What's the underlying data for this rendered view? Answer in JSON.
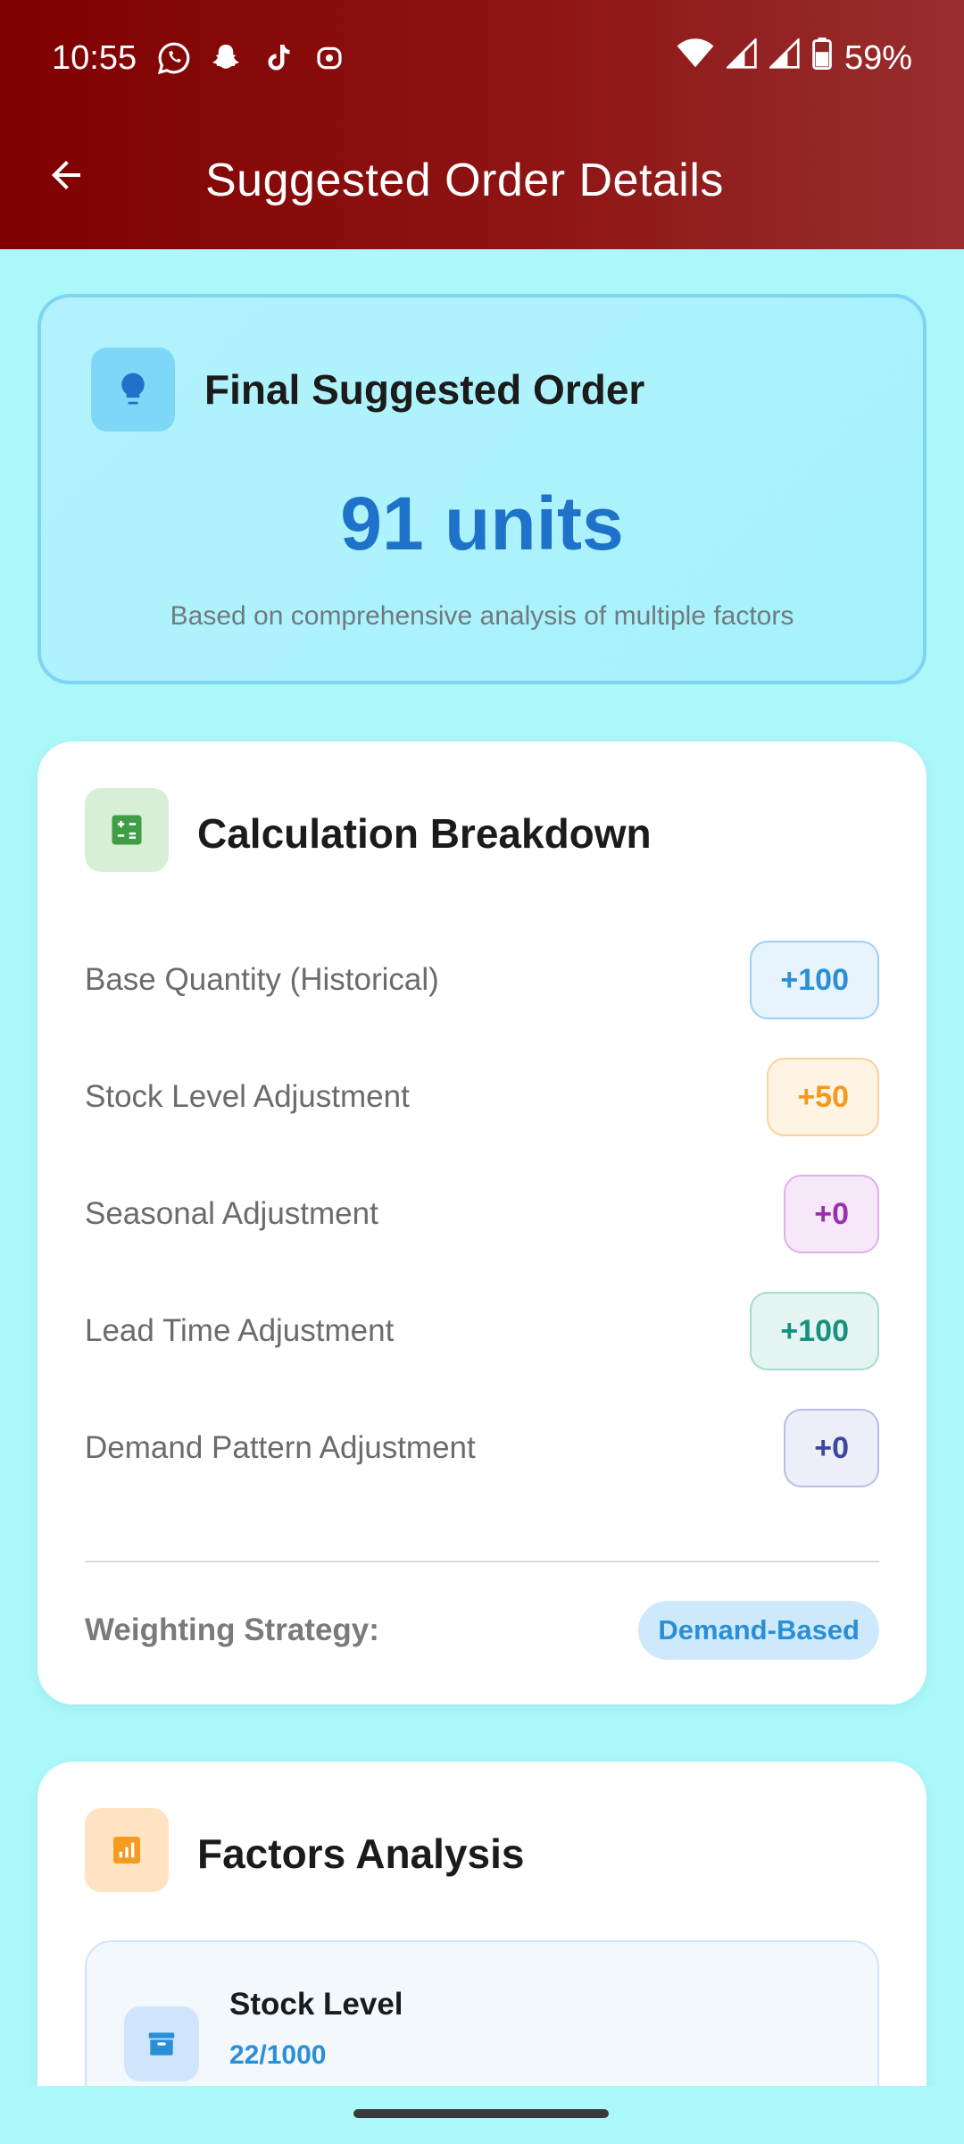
{
  "status_bar": {
    "time": "10:55",
    "battery": "59%",
    "icons": [
      "whatsapp-icon",
      "snapchat-icon",
      "tiktok-icon",
      "media-icon",
      "wifi-icon",
      "signal-icon",
      "signal-icon",
      "battery-icon"
    ]
  },
  "app_bar": {
    "title": "Suggested Order Details",
    "back_icon": "arrow-left-icon"
  },
  "final_order": {
    "heading": "Final Suggested Order",
    "value": "91 units",
    "subtitle": "Based on comprehensive analysis of multiple factors",
    "icon": "lightbulb-icon"
  },
  "calculation": {
    "heading": "Calculation Breakdown",
    "icon": "calculator-icon",
    "rows": [
      {
        "label": "Base Quantity (Historical)",
        "value": "+100",
        "color": "#2a8fd6"
      },
      {
        "label": "Stock Level Adjustment",
        "value": "+50",
        "color": "#f39a1e"
      },
      {
        "label": "Seasonal Adjustment",
        "value": "+0",
        "color": "#9a2fb0"
      },
      {
        "label": "Lead Time Adjustment",
        "value": "+100",
        "color": "#16907f"
      },
      {
        "label": "Demand Pattern Adjustment",
        "value": "+0",
        "color": "#3b47a0"
      }
    ],
    "weighting_label": "Weighting Strategy:",
    "weighting_value": "Demand-Based"
  },
  "factors": {
    "heading": "Factors Analysis",
    "icon": "bar-chart-icon",
    "items": [
      {
        "name": "Stock Level",
        "value": "22/1000",
        "icon": "archive-icon"
      }
    ]
  }
}
